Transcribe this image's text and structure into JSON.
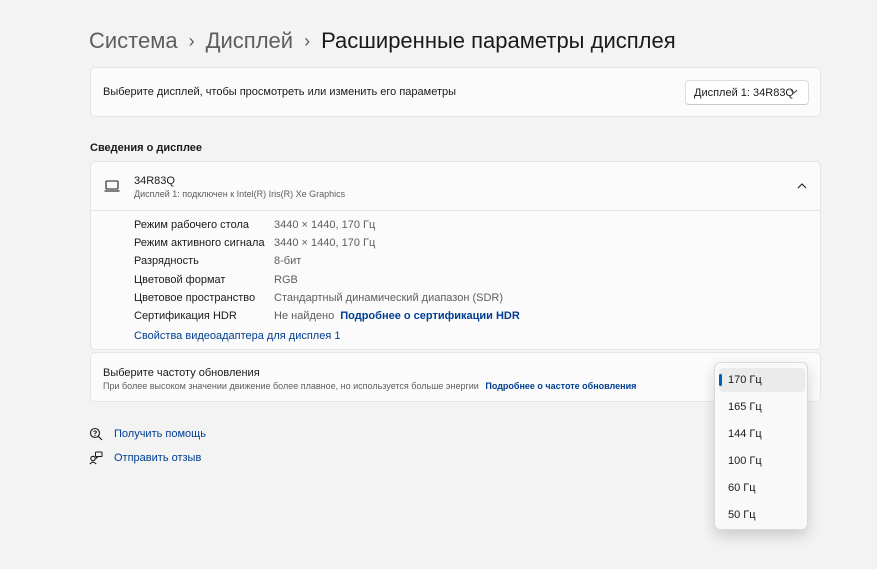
{
  "breadcrumb": {
    "items": [
      "Система",
      "Дисплей"
    ],
    "current": "Расширенные параметры дисплея",
    "separator": "›"
  },
  "display_select": {
    "description": "Выберите дисплей, чтобы просмотреть или изменить его параметры",
    "dropdown_value": "Дисплей 1: 34R83Q"
  },
  "display_info": {
    "section_title": "Сведения о дисплее",
    "monitor_name": "34R83Q",
    "monitor_sub": "Дисплей 1: подключен к Intel(R) Iris(R) Xe Graphics",
    "rows": [
      {
        "label": "Режим рабочего стола",
        "value": "3440 × 1440, 170 Гц",
        "link": ""
      },
      {
        "label": "Режим активного сигнала",
        "value": "3440 × 1440, 170 Гц",
        "link": ""
      },
      {
        "label": "Разрядность",
        "value": "8-бит",
        "link": ""
      },
      {
        "label": "Цветовой формат",
        "value": "RGB",
        "link": ""
      },
      {
        "label": "Цветовое пространство",
        "value": "Стандартный динамический диапазон (SDR)",
        "link": ""
      },
      {
        "label": "Сертификация HDR",
        "value": "Не найдено",
        "link": "Подробнее о сертификации HDR"
      }
    ],
    "adapter_link": "Свойства видеоадаптера для дисплея 1"
  },
  "refresh_rate": {
    "title": "Выберите частоту обновления",
    "description": "При более высоком значении движение более плавное, но используется больше энергии",
    "link": "Подробнее о частоте обновления",
    "options": [
      "170 Гц",
      "165 Гц",
      "144 Гц",
      "100 Гц",
      "60 Гц",
      "50 Гц"
    ],
    "selected": "170 Гц"
  },
  "help": {
    "get_help": "Получить помощь",
    "feedback": "Отправить отзыв"
  },
  "colors": {
    "background": "#f3f3f3",
    "card": "#fbfbfb",
    "link": "#003e92",
    "accent": "#005fb8"
  }
}
